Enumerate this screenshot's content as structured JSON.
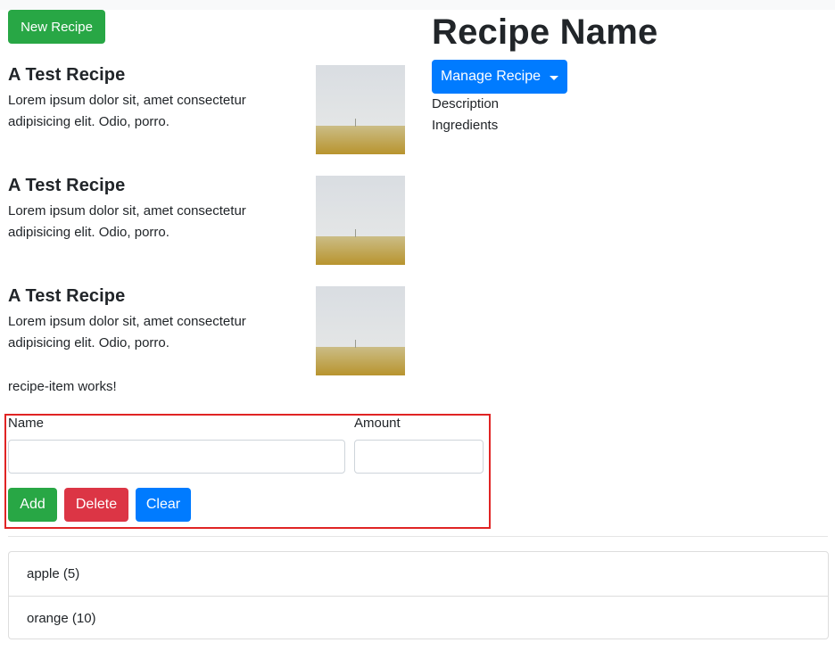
{
  "header": {
    "new_recipe_label": "New Recipe"
  },
  "recipes": [
    {
      "name": "A Test Recipe",
      "description": "Lorem ipsum dolor sit, amet consectetur adipisicing elit. Odio, porro."
    },
    {
      "name": "A Test Recipe",
      "description": "Lorem ipsum dolor sit, amet consectetur adipisicing elit. Odio, porro."
    },
    {
      "name": "A Test Recipe",
      "description": "Lorem ipsum dolor sit, amet consectetur adipisicing elit. Odio, porro."
    }
  ],
  "status_text": "recipe-item works!",
  "ingredient_form": {
    "name_label": "Name",
    "name_value": "",
    "amount_label": "Amount",
    "amount_value": "",
    "add_label": "Add",
    "delete_label": "Delete",
    "clear_label": "Clear"
  },
  "shopping_list": [
    {
      "text": "apple (5)"
    },
    {
      "text": "orange (10)"
    }
  ],
  "detail": {
    "title": "Recipe Name",
    "manage_label": "Manage Recipe",
    "description_label": "Description",
    "ingredients_label": "Ingredients"
  },
  "colors": {
    "success": "#28a745",
    "danger": "#dc3545",
    "primary": "#007bff",
    "highlight_border": "#e02424"
  },
  "icons": {
    "recipe_image": "foggy-field-image",
    "dropdown": "caret-down-icon"
  }
}
